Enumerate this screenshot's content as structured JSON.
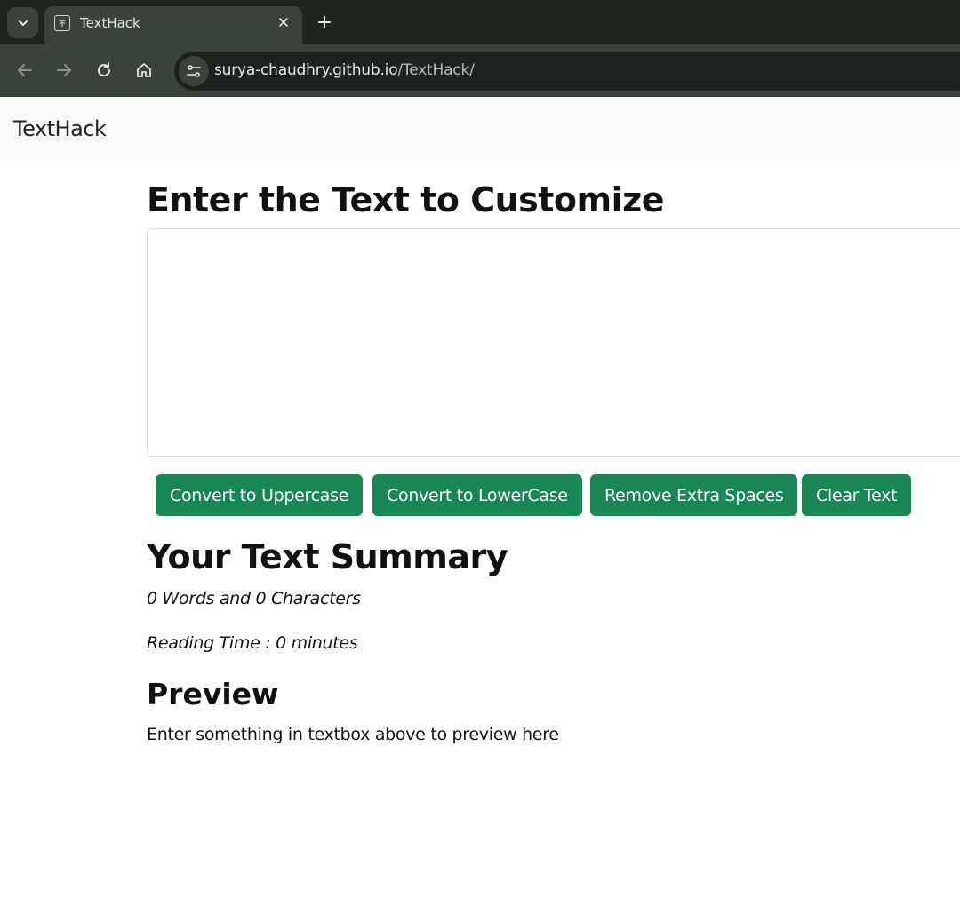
{
  "browser": {
    "tab": {
      "title": "TextHack"
    },
    "omnibox": {
      "url_host": "surya-chaudhry.github.io",
      "url_path": "/TextHack/"
    },
    "icons": [
      "tab-list-icon",
      "favicon-icon",
      "close-icon",
      "plus-icon",
      "back-icon",
      "forward-icon",
      "reload-icon",
      "home-icon",
      "site-settings-icon"
    ]
  },
  "navbar": {
    "brand": "TextHack"
  },
  "main": {
    "heading": "Enter the Text to Customize",
    "textbox": {
      "value": "",
      "placeholder": ""
    },
    "buttons": {
      "uppercase": "Convert to Uppercase",
      "lowercase": "Convert to LowerCase",
      "remove_spaces": "Remove Extra Spaces",
      "clear": "Clear Text"
    },
    "summary": {
      "heading": "Your Text Summary",
      "counts": "0 Words and 0 Characters",
      "reading_time": "Reading Time : 0 minutes"
    },
    "preview": {
      "heading": "Preview",
      "text": "Enter something in textbox above to preview here"
    }
  },
  "colors": {
    "button_bg": "#198754",
    "navbar_bg": "#f8f9fa",
    "chrome_dark": "#1f2620",
    "chrome_toolbar": "#3a423c"
  }
}
